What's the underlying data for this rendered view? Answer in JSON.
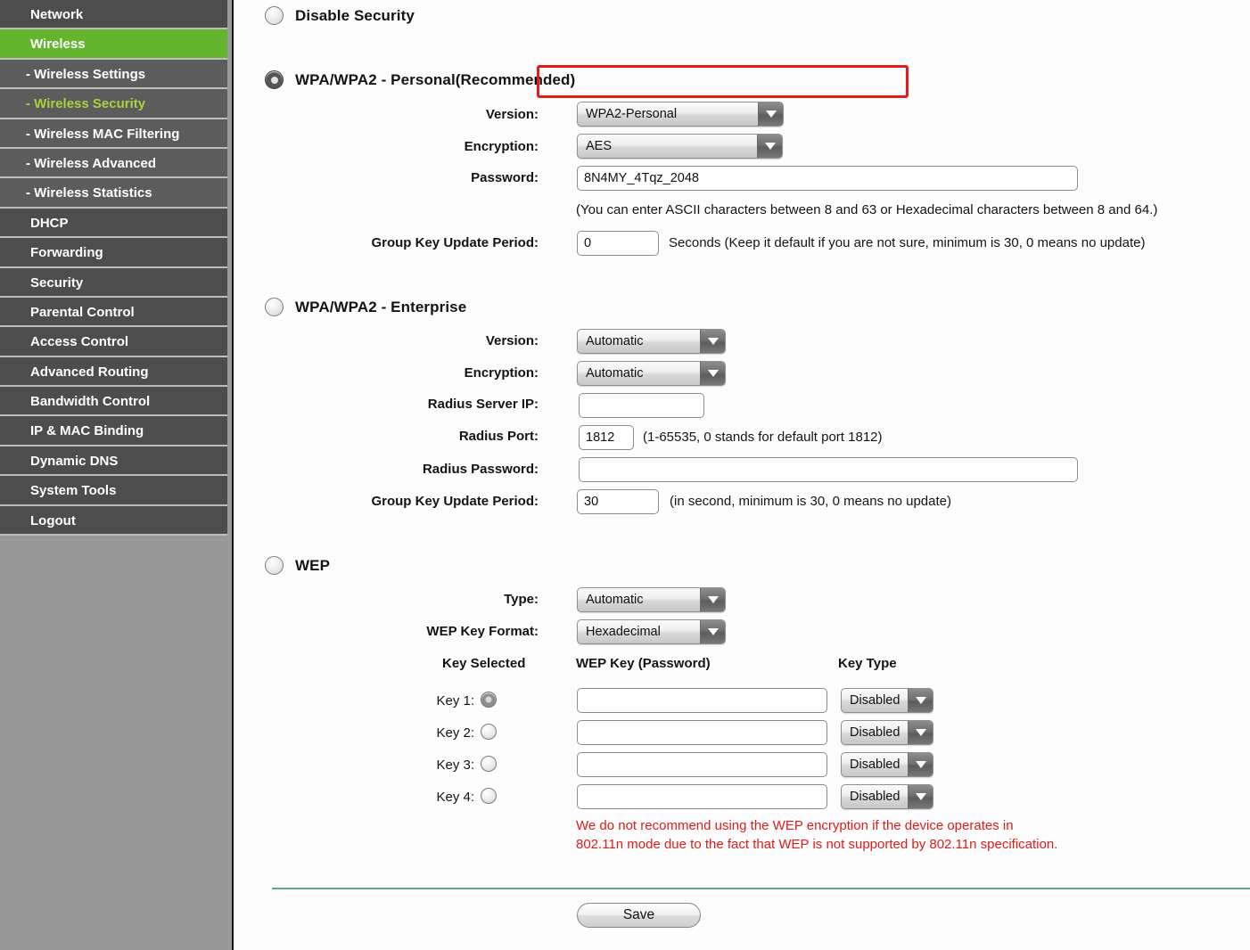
{
  "sidebar": {
    "items": [
      {
        "label": "Network",
        "type": "parent",
        "state": "normal"
      },
      {
        "label": "Wireless",
        "type": "parent",
        "state": "active"
      },
      {
        "label": "- Wireless Settings",
        "type": "sub",
        "state": "normal"
      },
      {
        "label": "- Wireless Security",
        "type": "sub",
        "state": "active"
      },
      {
        "label": "- Wireless MAC Filtering",
        "type": "sub",
        "state": "normal"
      },
      {
        "label": "- Wireless Advanced",
        "type": "sub",
        "state": "normal"
      },
      {
        "label": "- Wireless Statistics",
        "type": "sub",
        "state": "normal"
      },
      {
        "label": "DHCP",
        "type": "parent",
        "state": "normal"
      },
      {
        "label": "Forwarding",
        "type": "parent",
        "state": "normal"
      },
      {
        "label": "Security",
        "type": "parent",
        "state": "normal"
      },
      {
        "label": "Parental Control",
        "type": "parent",
        "state": "normal"
      },
      {
        "label": "Access Control",
        "type": "parent",
        "state": "normal"
      },
      {
        "label": "Advanced Routing",
        "type": "parent",
        "state": "normal"
      },
      {
        "label": "Bandwidth Control",
        "type": "parent",
        "state": "normal"
      },
      {
        "label": "IP & MAC Binding",
        "type": "parent",
        "state": "normal"
      },
      {
        "label": "Dynamic DNS",
        "type": "parent",
        "state": "normal"
      },
      {
        "label": "System Tools",
        "type": "parent",
        "state": "normal"
      },
      {
        "label": "Logout",
        "type": "parent",
        "state": "normal"
      }
    ],
    "active_color": "#64b42d",
    "active_text_color": "#a6d33c"
  },
  "disable_security": {
    "label": "Disable Security",
    "selected": false
  },
  "personal": {
    "label": "WPA/WPA2 - Personal(Recommended)",
    "selected": true,
    "highlight_color": "#e21b1b",
    "version_label": "Version:",
    "version_value": "WPA2-Personal",
    "encryption_label": "Encryption:",
    "encryption_value": "AES",
    "password_label": "Password:",
    "password_value": "8N4MY_4Tqz_2048",
    "password_hint": "(You can enter ASCII characters between 8 and 63 or Hexadecimal characters between 8 and 64.)",
    "group_key_label": "Group Key Update Period:",
    "group_key_value": "0",
    "group_key_hint": "Seconds (Keep it default if you are not sure, minimum is 30, 0 means no update)"
  },
  "enterprise": {
    "label": "WPA/WPA2 - Enterprise",
    "selected": false,
    "version_label": "Version:",
    "version_value": "Automatic",
    "encryption_label": "Encryption:",
    "encryption_value": "Automatic",
    "radius_ip_label": "Radius Server IP:",
    "radius_ip_value": "",
    "radius_port_label": "Radius Port:",
    "radius_port_value": "1812",
    "radius_port_hint": "(1-65535, 0 stands for default port 1812)",
    "radius_password_label": "Radius Password:",
    "radius_password_value": "",
    "group_key_label": "Group Key Update Period:",
    "group_key_value": "30",
    "group_key_hint": "(in second, minimum is 30, 0 means no update)"
  },
  "wep": {
    "label": "WEP",
    "selected": false,
    "type_label": "Type:",
    "type_value": "Automatic",
    "key_format_label": "WEP Key Format:",
    "key_format_value": "Hexadecimal",
    "col_key_selected": "Key Selected",
    "col_wep_key": "WEP Key (Password)",
    "col_key_type": "Key Type",
    "keys": [
      {
        "label": "Key 1:",
        "selected": true,
        "value": "",
        "type": "Disabled"
      },
      {
        "label": "Key 2:",
        "selected": false,
        "value": "",
        "type": "Disabled"
      },
      {
        "label": "Key 3:",
        "selected": false,
        "value": "",
        "type": "Disabled"
      },
      {
        "label": "Key 4:",
        "selected": false,
        "value": "",
        "type": "Disabled"
      }
    ],
    "warning_line1": "We do not recommend using the WEP encryption if the device operates in",
    "warning_line2": "802.11n mode due to the fact that WEP is not supported by 802.11n specification.",
    "warning_color": "#e01b1b"
  },
  "footer": {
    "save_label": "Save",
    "divider_color": "#5fa783"
  }
}
